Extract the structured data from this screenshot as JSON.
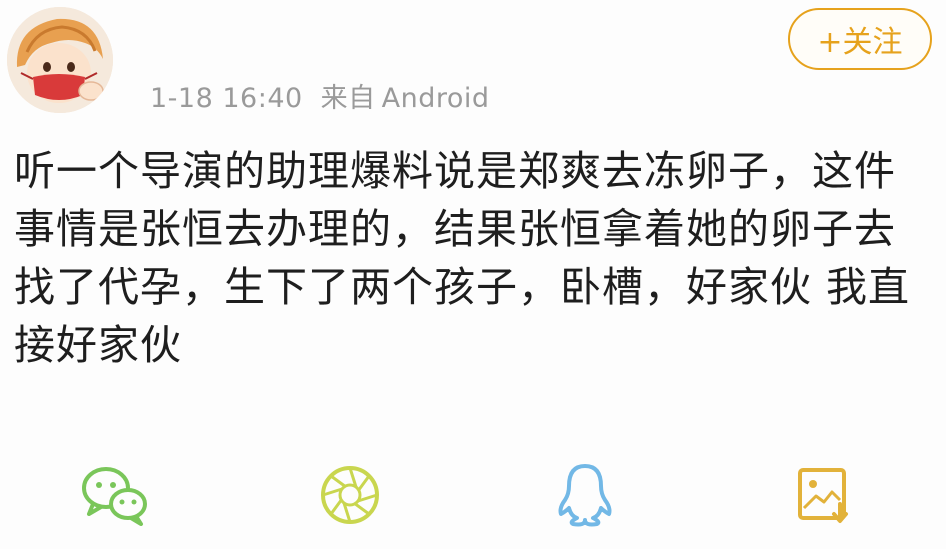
{
  "header": {
    "timestamp": "1-18 16:40",
    "source_label": "来自",
    "source_value": "Android",
    "follow_label": "+关注"
  },
  "post": {
    "text": "听一个导演的助理爆料说是郑爽去冻卵子，这件事情是张恒去办理的，结果张恒拿着她的卵子去找了代孕，生下了两个孩子，卧槽，好家伙  我直接好家伙"
  },
  "share_bar": {
    "icons": [
      "wechat-icon",
      "moments-icon",
      "qq-icon",
      "save-image-icon"
    ]
  },
  "colors": {
    "accent": "#e6a21c",
    "share_green": "#7ac65a",
    "share_moments": "#c9d64f",
    "share_qq": "#72b8e6",
    "share_save": "#e2b23a",
    "meta_text": "#9a9a9a"
  }
}
